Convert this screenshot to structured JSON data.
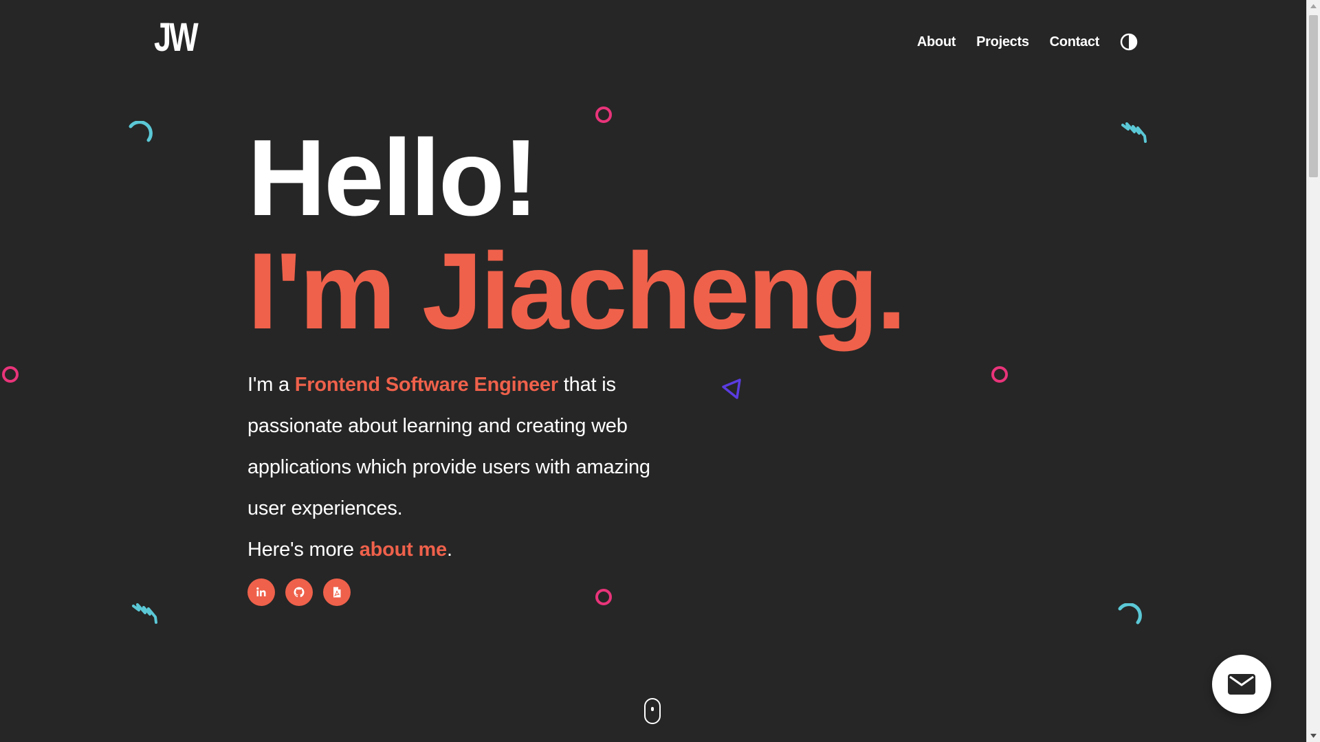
{
  "header": {
    "logo": "JW",
    "nav": [
      {
        "label": "About"
      },
      {
        "label": "Projects"
      },
      {
        "label": "Contact"
      }
    ],
    "theme_toggle_icon": "half-circle-contrast-icon"
  },
  "hero": {
    "greeting": "Hello!",
    "name_line": "I'm Jiacheng.",
    "bio_prefix": "I'm a ",
    "bio_role": "Frontend Software Engineer",
    "bio_rest": " that is passionate about learning and creating web applications which provide users with amazing user experiences.",
    "more_prefix": "Here's more ",
    "more_link": "about me",
    "more_suffix": ".",
    "socials": [
      {
        "icon": "linkedin-icon"
      },
      {
        "icon": "github-icon"
      },
      {
        "icon": "resume-pdf-icon"
      }
    ]
  },
  "colors": {
    "background": "#262626",
    "accent": "#ef614b",
    "deco_pink": "#e9347a",
    "deco_cyan": "#5bc8d6",
    "deco_purple": "#5a3ce0"
  },
  "floating": {
    "mail_icon": "envelope-icon",
    "scroll_hint_icon": "mouse-scroll-icon"
  }
}
